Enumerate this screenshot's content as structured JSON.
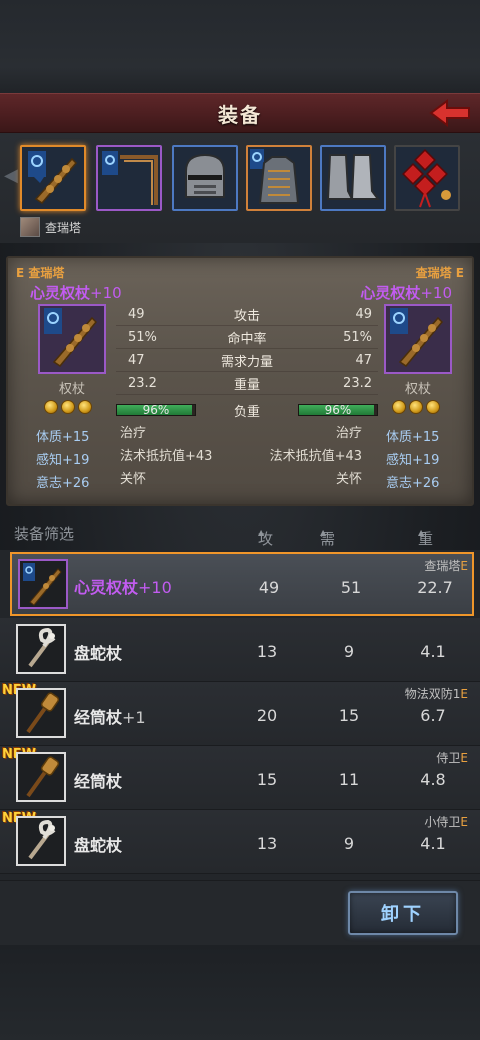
{
  "header": {
    "title": "装备"
  },
  "character": {
    "name": "查瑞塔"
  },
  "slots": [
    {
      "icon": "scepter-icon",
      "state": "selected"
    },
    {
      "icon": "banner-bow-icon",
      "state": "purple"
    },
    {
      "icon": "helmet-icon",
      "state": "blue"
    },
    {
      "icon": "chest-armor-icon",
      "state": "orange"
    },
    {
      "icon": "boots-icon",
      "state": "blue"
    },
    {
      "icon": "red-knot-charm-icon",
      "state": "plain"
    }
  ],
  "compare": {
    "left": {
      "owner": "查瑞塔",
      "grade": "E",
      "name": "心灵权杖",
      "plus": "+10",
      "type": "权杖",
      "attrs": [
        "体质+15",
        "感知+19",
        "意志+26"
      ]
    },
    "right": {
      "owner": "查瑞塔",
      "grade": "E",
      "name": "心灵权杖",
      "plus": "+10",
      "type": "权杖",
      "attrs": [
        "体质+15",
        "感知+19",
        "意志+26"
      ]
    },
    "stats": [
      {
        "label": "攻击",
        "left": "49",
        "right": "49"
      },
      {
        "label": "命中率",
        "left": "51%",
        "right": "51%"
      },
      {
        "label": "需求力量",
        "left": "47",
        "right": "47"
      },
      {
        "label": "重量",
        "left": "23.2",
        "right": "23.2"
      }
    ],
    "load": {
      "label": "负重",
      "left_pct": "96%",
      "right_pct": "96%",
      "left_value": 96,
      "right_value": 96
    },
    "skills": {
      "left": [
        "治疗",
        "法术抵抗值+43",
        "关怀"
      ],
      "right": [
        "治疗",
        "法术抵抗值+43",
        "关怀"
      ]
    }
  },
  "filter": {
    "label": "装备筛选",
    "col_attack": "攻击",
    "col_str": "需求力量",
    "col_weight": "重量"
  },
  "items": [
    {
      "name": "心灵权杖",
      "plus": "+10",
      "attack": "49",
      "str": "51",
      "weight": "22.7",
      "owner": "查瑞塔",
      "grade": "E",
      "new": "",
      "icon": "scepter-icon",
      "selected": true
    },
    {
      "name": "盘蛇杖",
      "plus": "",
      "attack": "13",
      "str": "9",
      "weight": "4.1",
      "owner": "",
      "grade": "",
      "new": "",
      "icon": "serpent-staff-icon"
    },
    {
      "name": "经筒杖",
      "plus": "+1",
      "attack": "20",
      "str": "15",
      "weight": "6.7",
      "owner": "物法双防1",
      "grade": "E",
      "new": "NEW",
      "icon": "prayer-wheel-staff-icon"
    },
    {
      "name": "经筒杖",
      "plus": "",
      "attack": "15",
      "str": "11",
      "weight": "4.8",
      "owner": "侍卫",
      "grade": "E",
      "new": "NEW",
      "icon": "prayer-wheel-staff-icon"
    },
    {
      "name": "盘蛇杖",
      "plus": "",
      "attack": "13",
      "str": "9",
      "weight": "4.1",
      "owner": "小侍卫",
      "grade": "E",
      "new": "NEW",
      "icon": "serpent-staff-icon"
    }
  ],
  "footer": {
    "unequip_label": "卸下"
  },
  "colors": {
    "accent_orange": "#f0962a",
    "rarity_purple": "#c25cf0",
    "attr_blue": "#a9cdf2",
    "header_red": "#5e2729"
  }
}
